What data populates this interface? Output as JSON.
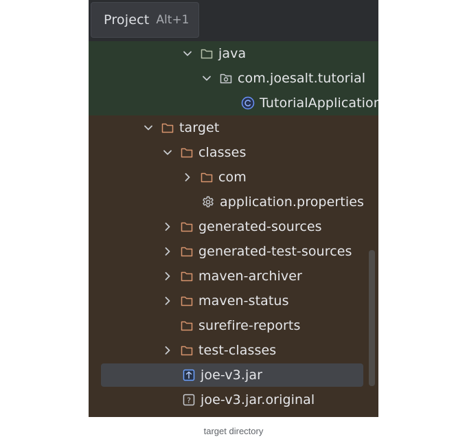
{
  "header": {
    "tab_title": "Project",
    "shortcut": "Alt+1"
  },
  "tree": [
    {
      "label": "java",
      "type": "folder",
      "state": "expanded",
      "group": "source",
      "selected": false
    },
    {
      "label": "com.joesalt.tutorial",
      "type": "package",
      "state": "expanded",
      "group": "source",
      "selected": false
    },
    {
      "label": "TutorialApplication",
      "type": "class",
      "state": "leaf",
      "group": "source",
      "selected": false
    },
    {
      "label": "target",
      "type": "folder",
      "state": "expanded",
      "group": "excluded",
      "selected": false
    },
    {
      "label": "classes",
      "type": "folder",
      "state": "expanded",
      "group": "excluded",
      "selected": false
    },
    {
      "label": "com",
      "type": "folder",
      "state": "collapsed",
      "group": "excluded",
      "selected": false
    },
    {
      "label": "application.properties",
      "type": "properties",
      "state": "leaf",
      "group": "excluded",
      "selected": false
    },
    {
      "label": "generated-sources",
      "type": "folder",
      "state": "collapsed",
      "group": "excluded",
      "selected": false
    },
    {
      "label": "generated-test-sources",
      "type": "folder",
      "state": "collapsed",
      "group": "excluded",
      "selected": false
    },
    {
      "label": "maven-archiver",
      "type": "folder",
      "state": "collapsed",
      "group": "excluded",
      "selected": false
    },
    {
      "label": "maven-status",
      "type": "folder",
      "state": "collapsed",
      "group": "excluded",
      "selected": false
    },
    {
      "label": "surefire-reports",
      "type": "folder",
      "state": "leaf",
      "group": "excluded",
      "selected": false
    },
    {
      "label": "test-classes",
      "type": "folder",
      "state": "collapsed",
      "group": "excluded",
      "selected": false
    },
    {
      "label": "joe-v3.jar",
      "type": "jar",
      "state": "leaf",
      "group": "excluded",
      "selected": true
    },
    {
      "label": "joe-v3.jar.original",
      "type": "unknown-file",
      "state": "leaf",
      "group": "excluded",
      "selected": false
    }
  ],
  "caption": "target directory",
  "icons": {
    "chevron_down": "chevron-down-icon",
    "chevron_right": "chevron-right-icon",
    "folder": "folder-icon",
    "package": "package-icon",
    "class": "class-icon",
    "settings": "settings-icon",
    "jar": "jar-icon",
    "unknown_file": "unknown-file-icon"
  },
  "colors": {
    "panel_bg": "#2b2d30",
    "source_band": "#2c3c2e",
    "excluded_band": "#3d3126",
    "folder_excluded": "#d8956e",
    "folder_source": "#b8c2ac",
    "class_icon": "#6a92f8",
    "jar_icon": "#6ca1ff",
    "text": "#e6e7ea"
  }
}
